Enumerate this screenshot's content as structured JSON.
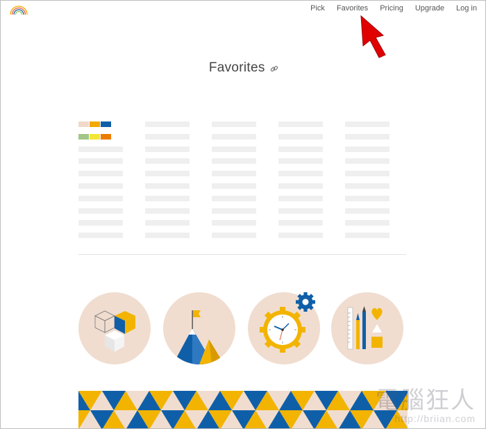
{
  "nav": {
    "links": [
      "Pick",
      "Favorites",
      "Pricing",
      "Upgrade",
      "Log in"
    ]
  },
  "page": {
    "title": "Favorites"
  },
  "palettes": [
    [
      "#f0d9c8",
      "#f2a900",
      "#0f5fa8"
    ],
    [
      "#a3c585",
      "#f4e635",
      "#ec7d00"
    ]
  ],
  "illustrations": [
    "cubes-illustration",
    "mountain-flag-illustration",
    "gear-clock-illustration",
    "design-tools-illustration"
  ],
  "watermark": {
    "title": "電腦狂人",
    "url": "http://briian.com"
  },
  "colors": {
    "accent_blue": "#0f5fa8",
    "accent_yellow": "#f2b400",
    "peach": "#f0ddd0",
    "cursor_red": "#e10000"
  }
}
